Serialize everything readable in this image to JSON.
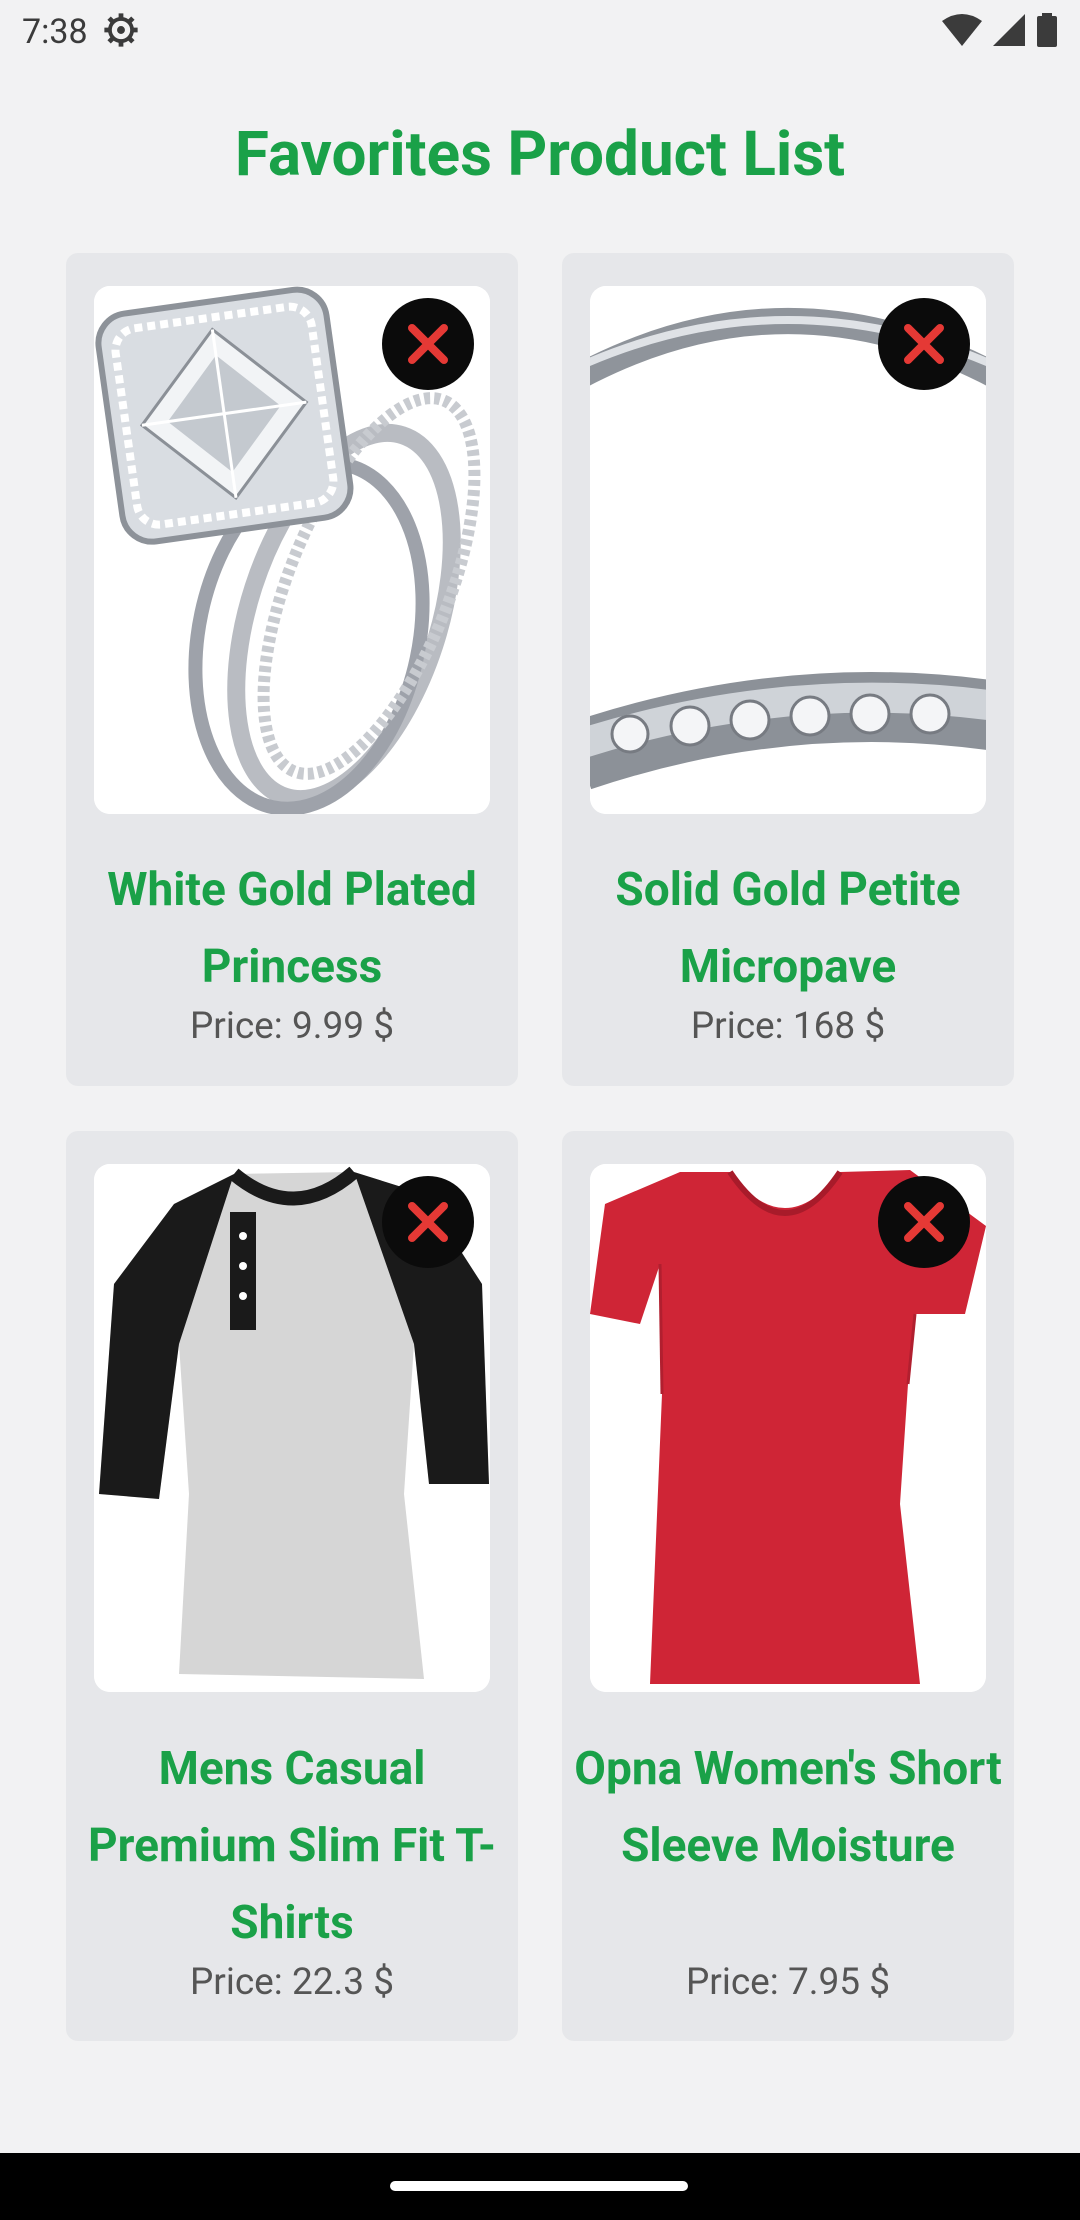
{
  "status_bar": {
    "time": "7:38",
    "icons": [
      "settings-icon",
      "wifi-icon",
      "signal-icon",
      "battery-icon"
    ]
  },
  "page": {
    "title": "Favorites Product List"
  },
  "products": [
    {
      "name": "White Gold Plated Princess",
      "price": "Price: 9.99 $",
      "image": "diamond-ring-set"
    },
    {
      "name": "Solid Gold Petite Micropave",
      "price": "Price: 168 $",
      "image": "micropave-band-ring"
    },
    {
      "name": "Mens Casual Premium Slim Fit T-Shirts",
      "price": "Price: 22.3 $",
      "image": "raglan-henley-shirt"
    },
    {
      "name": "Opna Women's Short Sleeve Moisture",
      "price": "Price: 7.95 $",
      "image": "red-vneck-tshirt"
    }
  ],
  "colors": {
    "title_green": "#1aa148",
    "card_background": "#e6e7ea",
    "remove_button": "#0b0b0b",
    "remove_icon": "#e53935"
  }
}
